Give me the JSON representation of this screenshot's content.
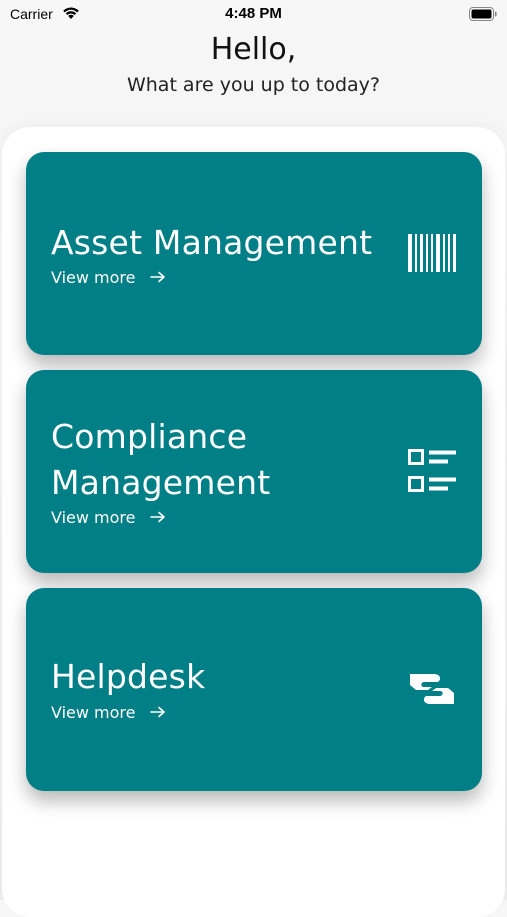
{
  "status_bar": {
    "carrier": "Carrier",
    "time": "4:48 PM",
    "icons": [
      "wifi-icon",
      "battery-icon"
    ]
  },
  "greeting": {
    "title": "Hello,",
    "subtitle": "What are you up to today?"
  },
  "cards": [
    {
      "title_lines": [
        "Asset Management"
      ],
      "link": "View more",
      "icon": "barcode-icon"
    },
    {
      "title_lines": [
        "Compliance",
        "Management"
      ],
      "link": "View more",
      "icon": "checklist-icon"
    },
    {
      "title_lines": [
        "Helpdesk"
      ],
      "link": "View more",
      "icon": "handshake-icon"
    }
  ],
  "colors": {
    "card": "#007f86",
    "text_on_card": "#ffffff",
    "background": "#f0f0f0",
    "sheet": "#ffffff"
  }
}
